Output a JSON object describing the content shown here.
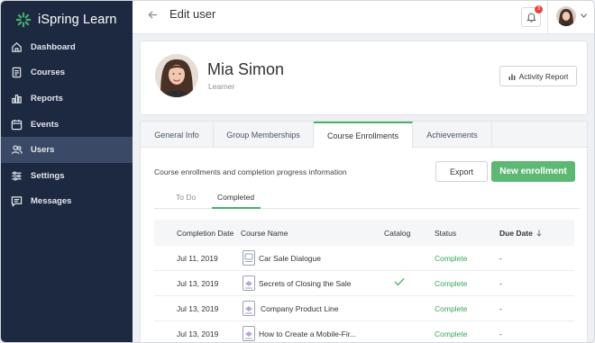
{
  "app": {
    "name": "iSpring Learn",
    "brand_color": "#45b26b"
  },
  "sidebar": {
    "items": [
      {
        "label": "Dashboard",
        "icon": "home-icon"
      },
      {
        "label": "Courses",
        "icon": "courses-icon"
      },
      {
        "label": "Reports",
        "icon": "reports-icon"
      },
      {
        "label": "Events",
        "icon": "calendar-icon"
      },
      {
        "label": "Users",
        "icon": "users-icon",
        "active": true
      },
      {
        "label": "Settings",
        "icon": "settings-icon"
      },
      {
        "label": "Messages",
        "icon": "messages-icon"
      }
    ]
  },
  "header": {
    "title": "Edit user",
    "notifications_count": "3"
  },
  "profile": {
    "name": "Mia Simon",
    "role": "Learner",
    "report_button": "Activity Report"
  },
  "tabs": [
    {
      "label": "General Info"
    },
    {
      "label": "Group Memberships"
    },
    {
      "label": "Course Enrollments",
      "active": true
    },
    {
      "label": "Achievements"
    }
  ],
  "enrollments": {
    "description": "Course enrollments and completion progress information",
    "export_label": "Export",
    "new_label": "New enrollment",
    "subtabs": [
      {
        "label": "To Do"
      },
      {
        "label": "Completed",
        "active": true
      }
    ],
    "columns": {
      "completion_date": "Completion Date",
      "course_name": "Course Name",
      "catalog": "Catalog",
      "status": "Status",
      "due_date": "Due Date",
      "sort_icon": "arrow-down-icon"
    },
    "rows": [
      {
        "date": "Jul 11, 2019",
        "course": "Car Sale Dialogue",
        "catalog": false,
        "status": "Complete",
        "due": "-"
      },
      {
        "date": "Jul 13, 2019",
        "course": "Secrets of Closing the Sale",
        "catalog": true,
        "status": "Complete",
        "due": "-"
      },
      {
        "date": "Jul 13, 2019",
        "course": "Company Product Line",
        "catalog": false,
        "status": "Complete",
        "due": "-"
      },
      {
        "date": "Jul 13, 2019",
        "course": "How to Create a Mobile-Fir...",
        "catalog": false,
        "status": "Complete",
        "due": "-"
      }
    ]
  }
}
